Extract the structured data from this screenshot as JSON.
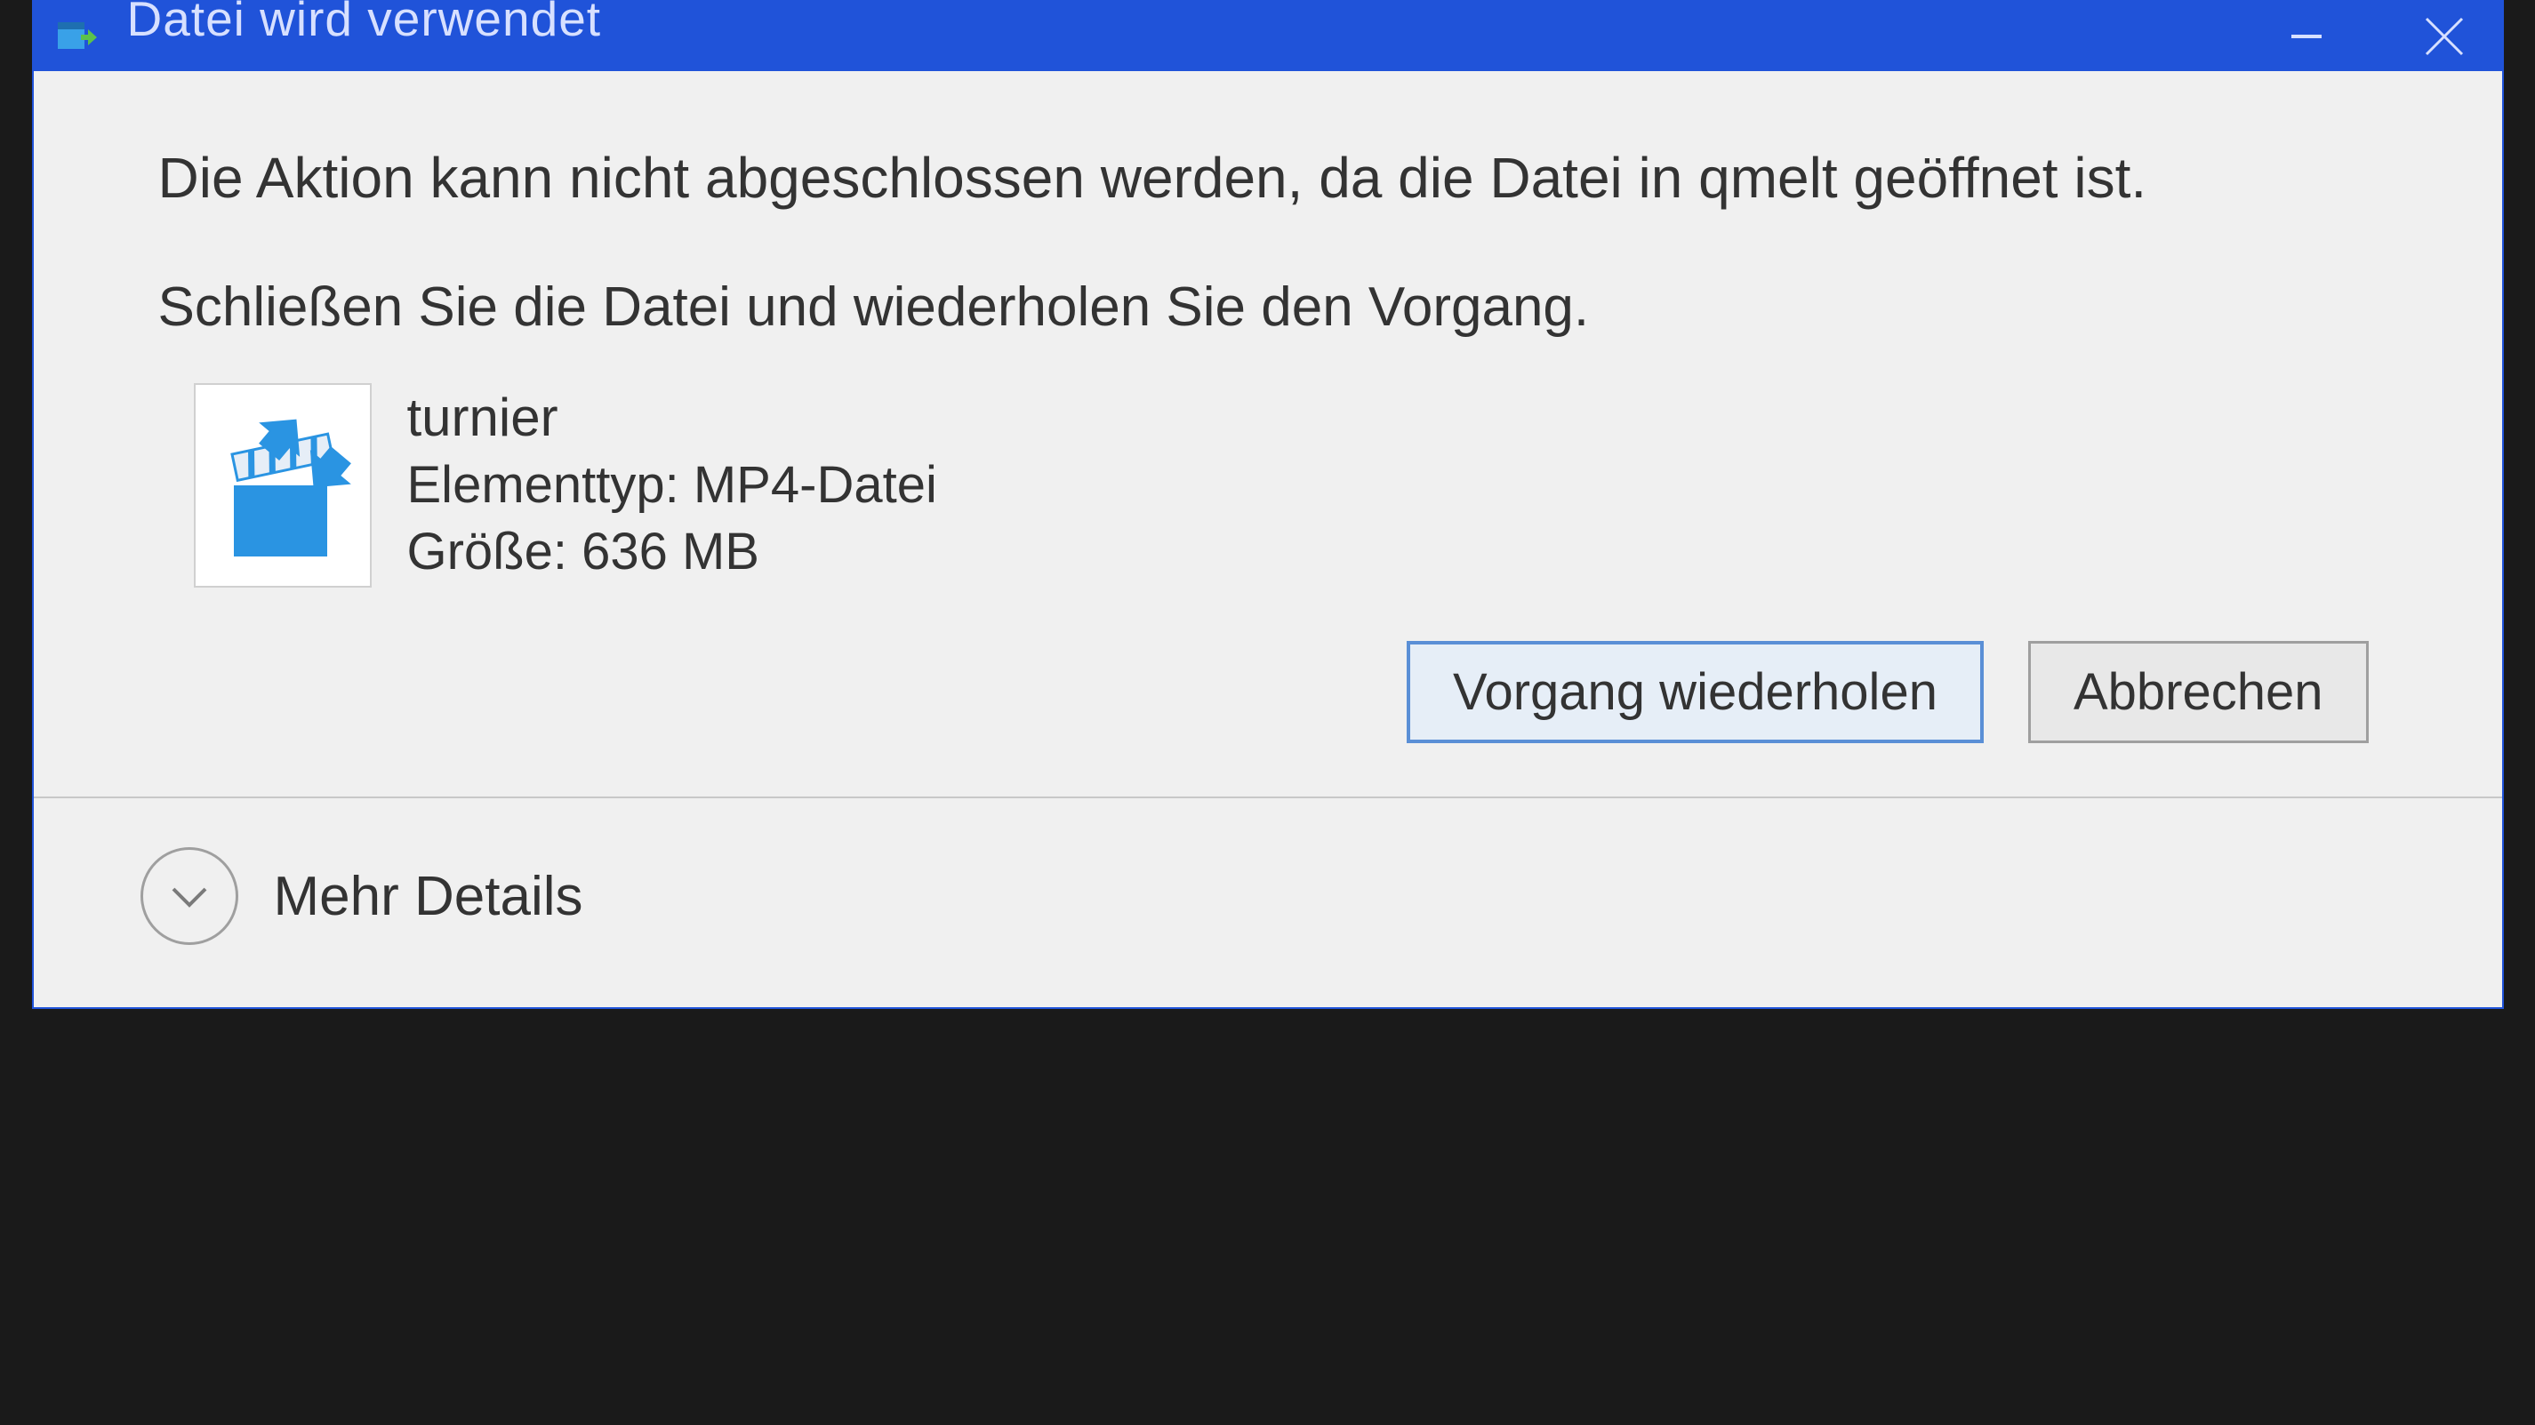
{
  "titlebar": {
    "title": "Datei wird verwendet"
  },
  "content": {
    "main_message": "Die Aktion kann nicht abgeschlossen werden, da die Datei in qmelt geöffnet ist.",
    "instruction": "Schließen Sie die Datei und wiederholen Sie den Vorgang.",
    "file": {
      "name": "turnier",
      "type_label": "Elementtyp: MP4-Datei",
      "size_label": "Größe: 636 MB"
    }
  },
  "buttons": {
    "retry": "Vorgang wiederholen",
    "cancel": "Abbrechen"
  },
  "footer": {
    "more_details": "Mehr Details"
  }
}
